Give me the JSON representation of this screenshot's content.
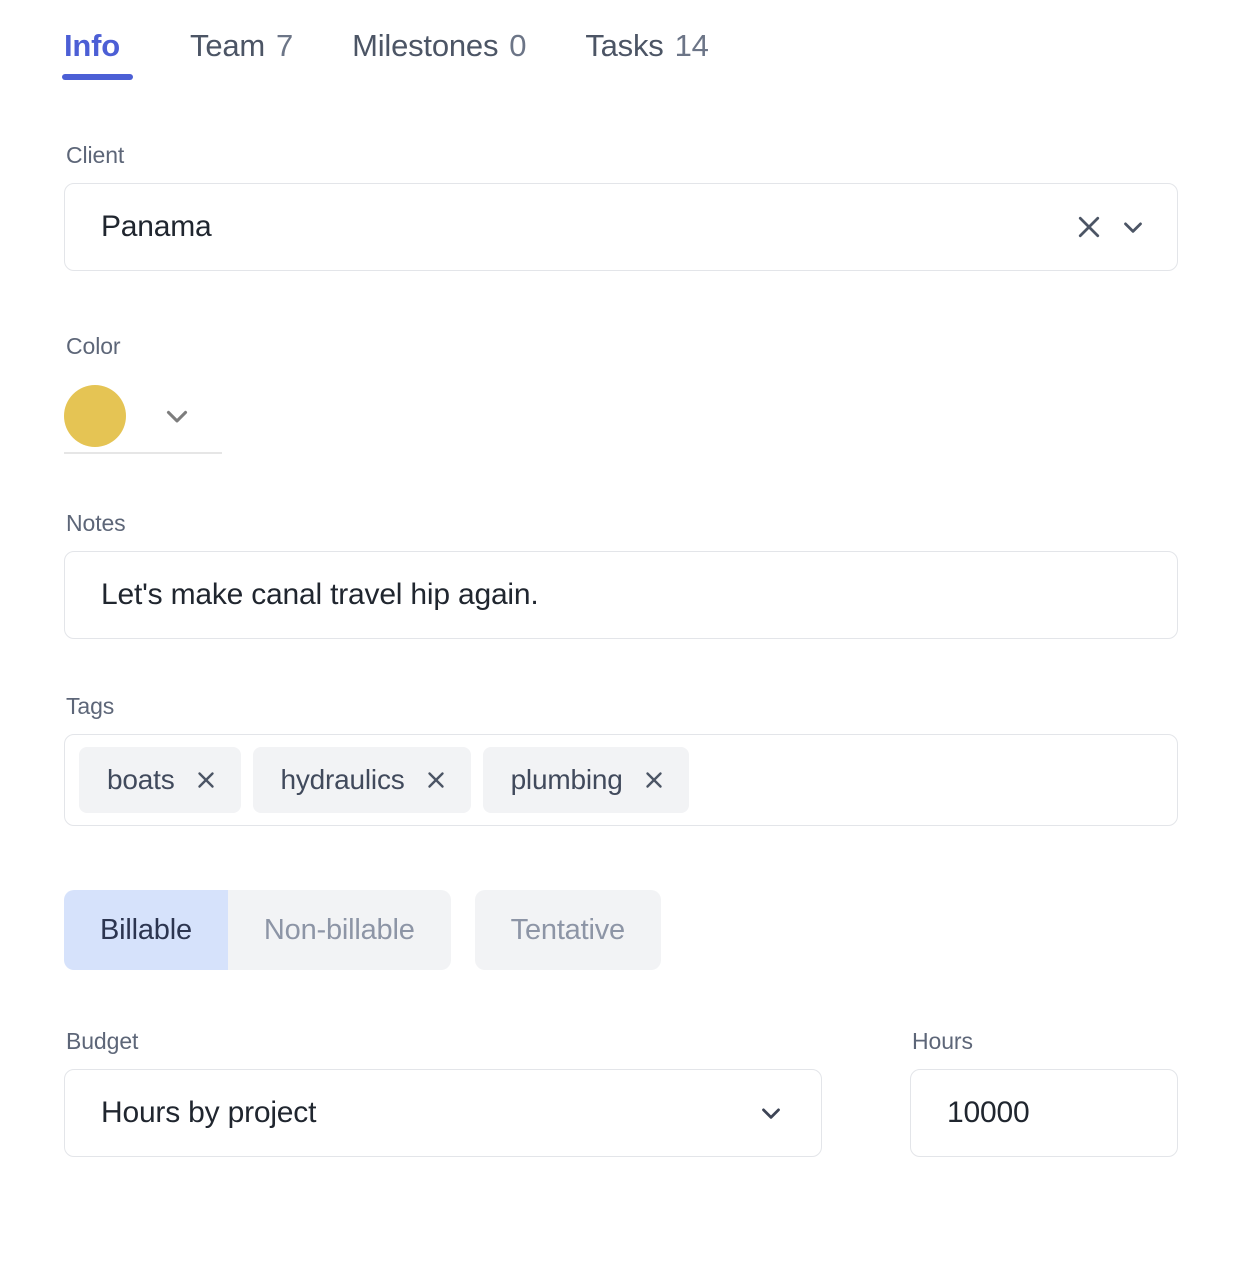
{
  "tabs": [
    {
      "label": "Info",
      "count": "",
      "active": true
    },
    {
      "label": "Team",
      "count": "7",
      "active": false
    },
    {
      "label": "Milestones",
      "count": "0",
      "active": false
    },
    {
      "label": "Tasks",
      "count": "14",
      "active": false
    }
  ],
  "accent_color": "#4c5fd5",
  "client": {
    "label": "Client",
    "value": "Panama",
    "clear_icon": "close-icon",
    "dropdown_icon": "chevron-down-icon"
  },
  "color": {
    "label": "Color",
    "swatch_hex": "#e5c454",
    "dropdown_icon": "chevron-down-icon"
  },
  "notes": {
    "label": "Notes",
    "value": "Let's make canal travel hip again."
  },
  "tags": {
    "label": "Tags",
    "items": [
      {
        "name": "boats",
        "remove_icon": "close-icon"
      },
      {
        "name": "hydraulics",
        "remove_icon": "close-icon"
      },
      {
        "name": "plumbing",
        "remove_icon": "close-icon"
      }
    ]
  },
  "billing": {
    "options": [
      {
        "label": "Billable",
        "selected": true
      },
      {
        "label": "Non-billable",
        "selected": false
      },
      {
        "label": "Tentative",
        "selected": false
      }
    ],
    "selected_bg": "#d6e2fb",
    "unselected_bg": "#f2f3f5"
  },
  "budget": {
    "label": "Budget",
    "value": "Hours by project",
    "dropdown_icon": "chevron-down-icon"
  },
  "hours": {
    "label": "Hours",
    "value": "10000"
  }
}
